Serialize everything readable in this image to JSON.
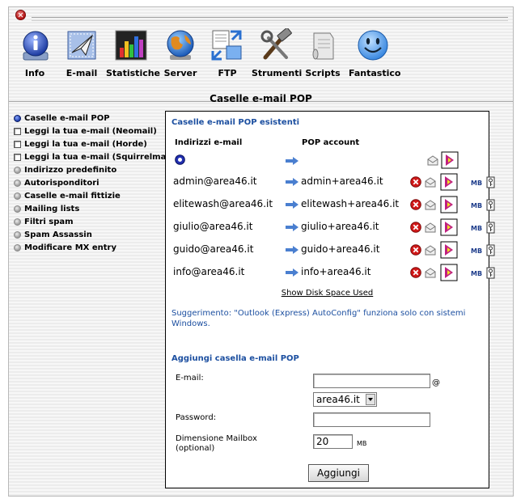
{
  "toolbar": {
    "items": [
      {
        "label": "Info",
        "icon": "info-icon"
      },
      {
        "label": "E-mail",
        "icon": "email-icon"
      },
      {
        "label": "Statistiche",
        "icon": "statistics-icon"
      },
      {
        "label": "Server",
        "icon": "globe-icon"
      },
      {
        "label": "FTP",
        "icon": "ftp-icon"
      },
      {
        "label": "Strumenti",
        "icon": "tools-icon"
      },
      {
        "label": "Scripts",
        "icon": "scripts-icon"
      },
      {
        "label": "Fantastico",
        "icon": "smiley-icon"
      }
    ]
  },
  "page": {
    "title": "Caselle e-mail POP"
  },
  "sidebar": {
    "items": [
      {
        "label": "Caselle e-mail POP",
        "marker": "dot-active"
      },
      {
        "label": "Leggi la tua e-mail (Neomail)",
        "marker": "box"
      },
      {
        "label": "Leggi la tua e-mail (Horde)",
        "marker": "box"
      },
      {
        "label": "Leggi la tua e-mail (Squirrelmail)",
        "marker": "box"
      },
      {
        "label": "Indirizzo predefinito",
        "marker": "dot"
      },
      {
        "label": "Autorisponditori",
        "marker": "dot"
      },
      {
        "label": "Caselle e-mail fittizie",
        "marker": "dot"
      },
      {
        "label": "Mailing lists",
        "marker": "dot"
      },
      {
        "label": "Filtri spam",
        "marker": "dot"
      },
      {
        "label": "Spam Assassin",
        "marker": "dot"
      },
      {
        "label": "Modificare MX entry",
        "marker": "dot"
      }
    ]
  },
  "accounts": {
    "title": "Caselle e-mail POP esistenti",
    "col_address": "Indirizzi e-mail",
    "col_pop": "POP account",
    "mb_label": "MB",
    "rows": [
      {
        "address": "admin@area46.it",
        "pop": "admin+area46.it"
      },
      {
        "address": "elitewash@area46.it",
        "pop": "elitewash+area46.it"
      },
      {
        "address": "giulio@area46.it",
        "pop": "giulio+area46.it"
      },
      {
        "address": "guido@area46.it",
        "pop": "guido+area46.it"
      },
      {
        "address": "info@area46.it",
        "pop": "info+area46.it"
      }
    ],
    "disk_link": "Show Disk Space Used"
  },
  "hint": "Suggerimento: \"Outlook (Express) AutoConfig\" funziona solo con sistemi Windows.",
  "add_form": {
    "title": "Aggiungi casella e-mail POP",
    "email_label": "E-mail:",
    "email_value": "",
    "at_sign": "@",
    "domain_selected": "area46.it",
    "password_label": "Password:",
    "password_value": "",
    "quota_label_line1": "Dimensione Mailbox",
    "quota_label_line2": "(optional)",
    "quota_value": "20",
    "quota_unit": "MB",
    "submit_label": "Aggiungi"
  },
  "colors": {
    "accent": "#1c4fa0",
    "arrow": "#4a7fd0",
    "delete": "#d01818"
  }
}
